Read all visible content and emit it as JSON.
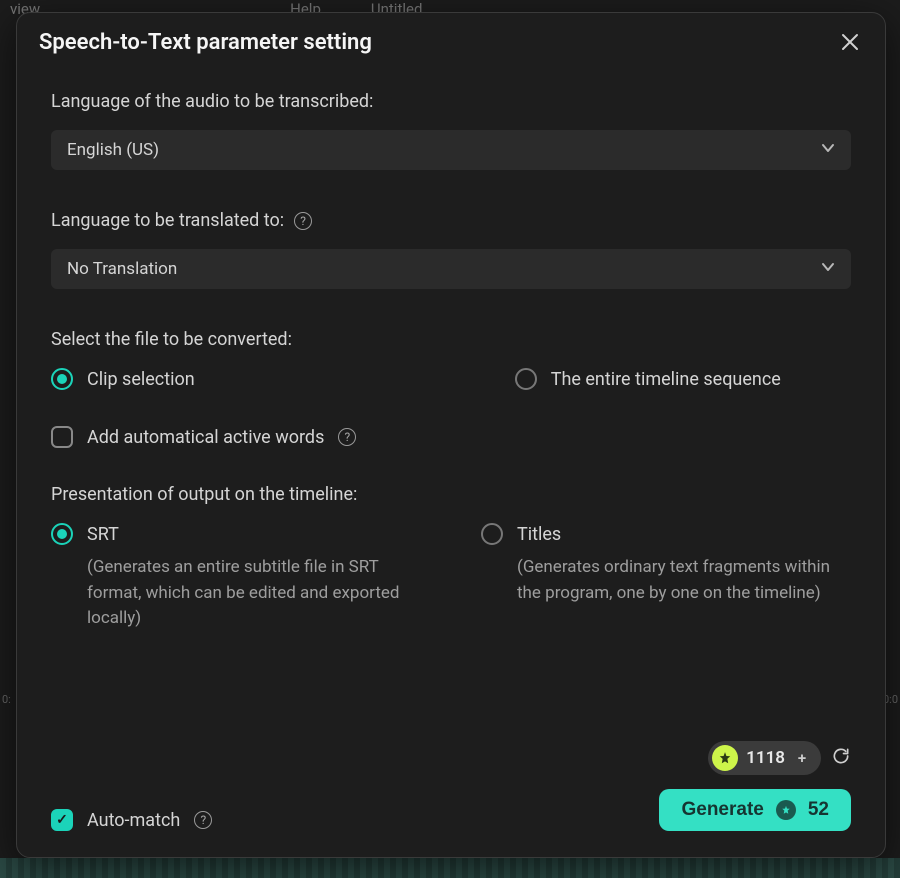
{
  "bg": {
    "view": "view",
    "help": "Help",
    "untitled": "Untitled",
    "mark_left": "0:",
    "mark_right": "0:0"
  },
  "modal": {
    "title": "Speech-to-Text parameter setting",
    "language_label": "Language of the audio to be transcribed:",
    "language_value": "English (US)",
    "translate_label": "Language to be translated to:",
    "translate_value": "No Translation",
    "file_label": "Select the file to be converted:",
    "file_options": {
      "clip": "Clip selection",
      "timeline": "The entire timeline sequence"
    },
    "active_words_label": "Add automatical active words",
    "output_label": "Presentation of output on the timeline:",
    "output": {
      "srt": {
        "label": "SRT",
        "desc": "(Generates an entire subtitle file in SRT format, which can be edited and exported locally)"
      },
      "titles": {
        "label": "Titles",
        "desc": "(Generates ordinary text fragments within the program, one by one on the timeline)"
      }
    },
    "auto_match_label": "Auto-match",
    "credits": "1118",
    "generate_label": "Generate",
    "generate_cost": "52"
  }
}
